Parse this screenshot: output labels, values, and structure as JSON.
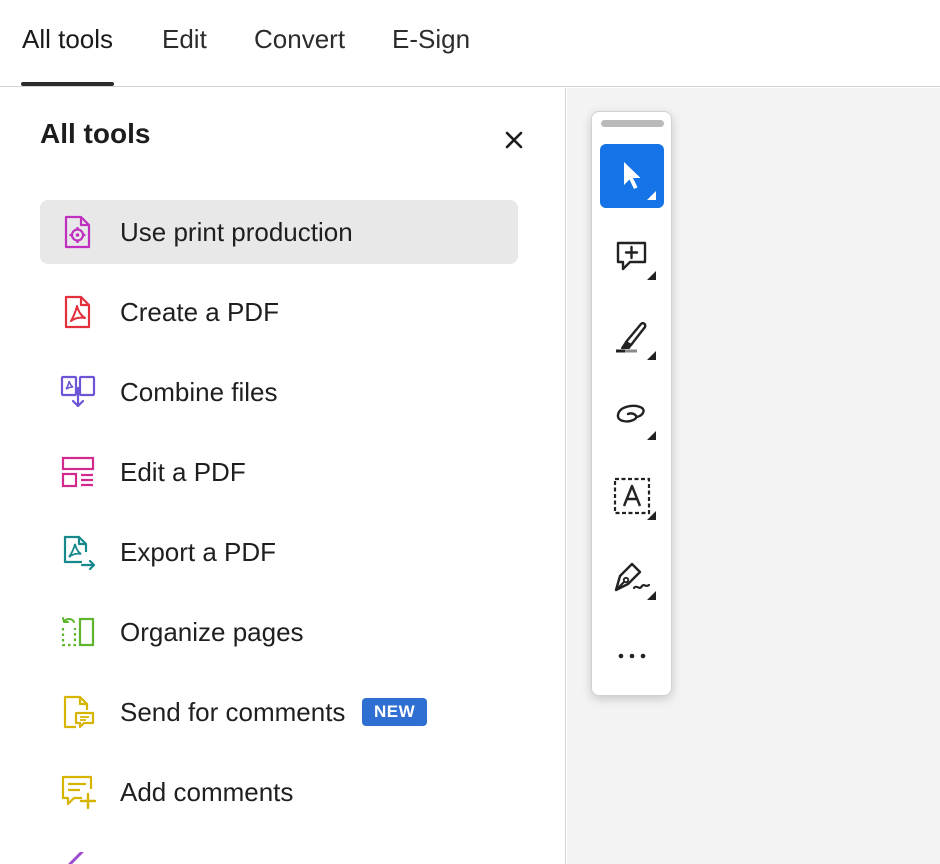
{
  "tabs": [
    {
      "label": "All tools",
      "active": true
    },
    {
      "label": "Edit"
    },
    {
      "label": "Convert"
    },
    {
      "label": "E-Sign"
    }
  ],
  "panel": {
    "title": "All tools",
    "tools": [
      {
        "label": "Use print production",
        "icon": "print-production-icon",
        "color": "#c02fbf",
        "selected": true
      },
      {
        "label": "Create a PDF",
        "icon": "create-pdf-icon",
        "color": "#e2303c"
      },
      {
        "label": "Combine files",
        "icon": "combine-files-icon",
        "color": "#6f55d6"
      },
      {
        "label": "Edit a PDF",
        "icon": "edit-pdf-icon",
        "color": "#d2298e"
      },
      {
        "label": "Export a PDF",
        "icon": "export-pdf-icon",
        "color": "#17898c"
      },
      {
        "label": "Organize pages",
        "icon": "organize-pages-icon",
        "color": "#5db52c"
      },
      {
        "label": "Send for comments",
        "icon": "send-comments-icon",
        "color": "#d6b400",
        "badge": "NEW"
      },
      {
        "label": "Add comments",
        "icon": "add-comments-icon",
        "color": "#d6b400"
      }
    ]
  },
  "toolbar": {
    "tools": [
      {
        "icon": "select-cursor-icon",
        "active": true
      },
      {
        "icon": "add-comment-icon"
      },
      {
        "icon": "highlight-icon"
      },
      {
        "icon": "draw-lasso-icon"
      },
      {
        "icon": "text-select-icon"
      },
      {
        "icon": "sign-pen-icon"
      },
      {
        "icon": "more-icon"
      }
    ]
  },
  "colors": {
    "accent": "#1473e6",
    "badge": "#2f6fd1",
    "selected_row": "#e8e8e8",
    "canvas_bg": "#f3f3f3"
  }
}
